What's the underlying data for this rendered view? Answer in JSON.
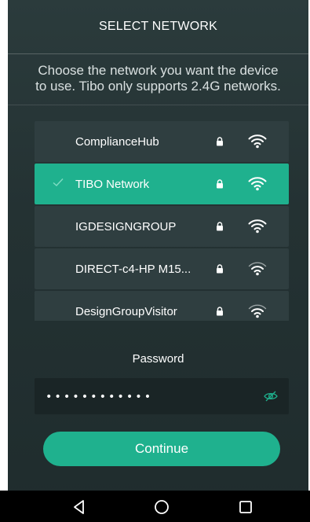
{
  "header": {
    "title": "SELECT NETWORK"
  },
  "instructions": {
    "line1": "Choose the network you want the device",
    "line2": "to use. Tibo only supports 2.4G networks."
  },
  "networks": [
    {
      "ssid": "ComplianceHub",
      "secured": true,
      "selected": false
    },
    {
      "ssid": "TIBO Network",
      "secured": true,
      "selected": true
    },
    {
      "ssid": "IGDESIGNGROUP",
      "secured": true,
      "selected": false
    },
    {
      "ssid": "DIRECT-c4-HP M15...",
      "secured": true,
      "selected": false
    },
    {
      "ssid": "DesignGroupVisitor",
      "secured": true,
      "selected": false
    }
  ],
  "password": {
    "label": "Password",
    "value": "••••••••••••"
  },
  "continue_label": "Continue",
  "colors": {
    "accent": "#1fb18e",
    "row": "#2f3e40",
    "background": "#243233"
  },
  "icons": {
    "check": "check-icon",
    "lock": "lock-icon",
    "wifi": "wifi-icon",
    "eye": "eye-off-icon",
    "nav_back": "back-triangle-icon",
    "nav_home": "home-circle-icon",
    "nav_recents": "recents-square-icon"
  }
}
